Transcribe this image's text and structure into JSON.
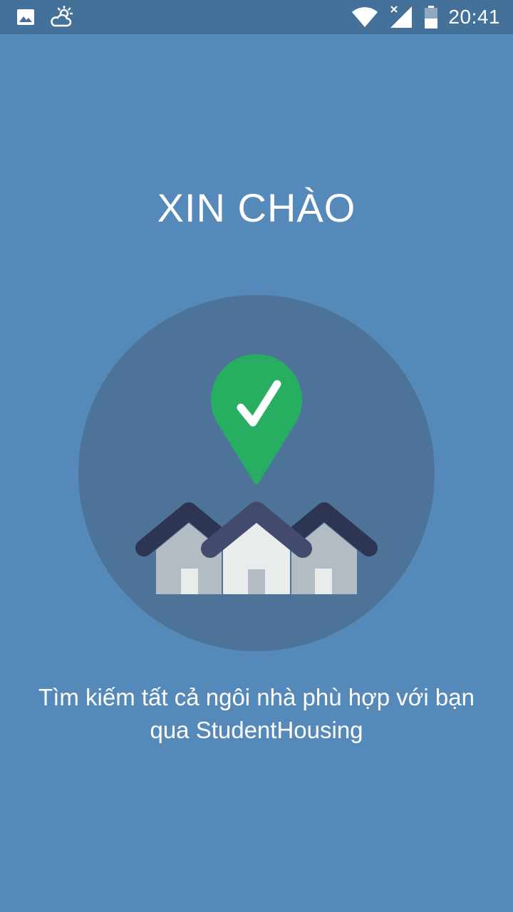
{
  "status_bar": {
    "time": "20:41",
    "icons": {
      "left": [
        "image-icon",
        "weather-cloud-sun-icon"
      ],
      "right": [
        "wifi-icon",
        "cellular-signal-no-data-icon",
        "battery-icon"
      ]
    },
    "colors": {
      "background": "#44719a",
      "foreground": "#ffffff"
    }
  },
  "welcome": {
    "title": "XIN CHÀO",
    "subtitle_line1": "Tìm kiếm tất cả ngôi nhà phù hợp với bạn",
    "subtitle_line2": "qua StudentHousing"
  },
  "illustration": {
    "icons": [
      "location-pin-check-icon",
      "houses-icon"
    ],
    "colors": {
      "circle": "#4d7398",
      "pin": "#27ae60",
      "roof_dark": "#2d3553",
      "roof_mid": "#424a6e",
      "house_side": "#b3bcc3",
      "house_front": "#e8eced"
    }
  },
  "theme": {
    "background": "#5589b9",
    "text": "#ffffff"
  }
}
